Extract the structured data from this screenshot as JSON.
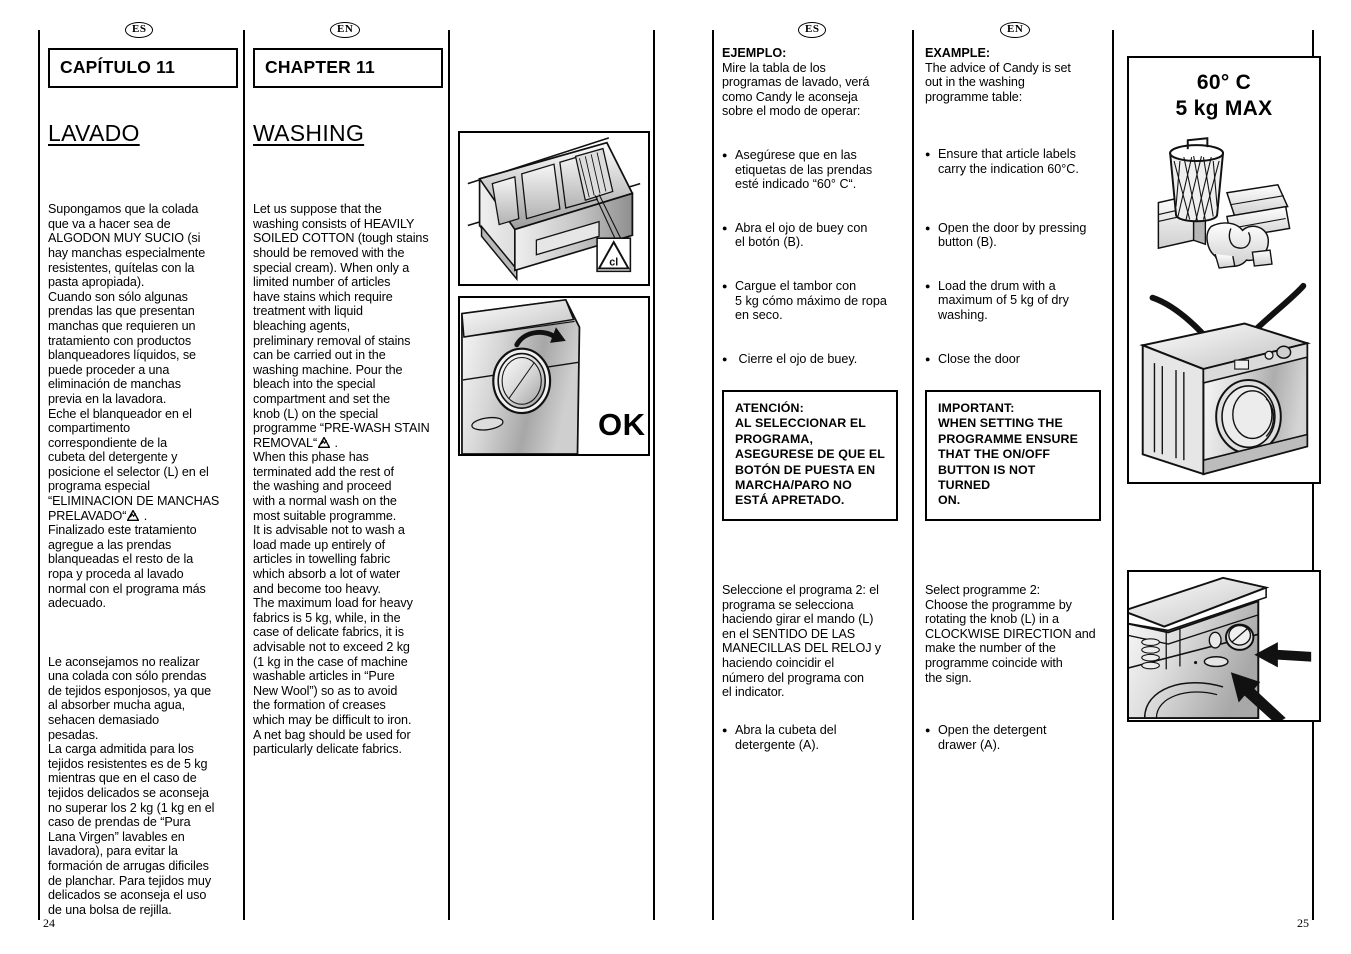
{
  "document": {
    "page_left_number": "24",
    "page_right_number": "25"
  },
  "left_page": {
    "es": {
      "lang_badge": "ES",
      "chapter_label": "CAPÍTULO 11",
      "section_title": "LAVADO",
      "paragraphs": [
        "Supongamos que la colada\nque va a hacer sea de\nALGODON MUY SUCIO (si\nhay manchas especialmente\nresistentes, quítelas con la\npasta apropiada).\nCuando son sólo algunas\nprendas las que presentan\nmanchas que requieren un\ntratamiento con productos\nblanqueadores líquidos, se\npuede proceder a una\neliminación de manchas\nprevia en la lavadora.\nEche el blanqueador en el\ncompartimento\ncorrespondiente de la\ncubeta del detergente y\nposicione el selector (L) en el\nprograma especial\n“ELIMINACION DE MANCHAS\nPRELAVADO“",
        " .\nFinalizado este tratamiento\nagregue a las prendas\nblanqueadas el resto de la\nropa y proceda al lavado\nnormal con el programa más\nadecuado.",
        "Le aconsejamos no realizar\nuna colada con sólo prendas\nde tejidos esponjosos, ya que\nal absorber mucha agua,\nsehacen demasiado\npesadas.\nLa carga admitida para los\ntejidos resistentes es de 5 kg\nmientras que en el caso de\ntejidos delicados se aconseja\nno superar los 2 kg (1 kg en el\ncaso de prendas de “Pura\nLana Virgen” lavables en\nlavadora), para evitar la\nformación de arrugas dificiles\nde planchar. Para tejidos muy\ndelicados se aconseja el uso\nde una bolsa de rejilla."
      ]
    },
    "en": {
      "lang_badge": "EN",
      "chapter_label": "CHAPTER 11",
      "section_title": "WASHING",
      "paragraphs": [
        "Let us suppose that the\nwashing consists of HEAVILY\nSOILED COTTON (tough stains\nshould be removed with the\nspecial cream). When only a\nlimited number of articles\nhave stains which require\ntreatment with liquid\nbleaching agents,\npreliminary removal of stains\ncan be carried out in the\nwashing machine. Pour the\nbleach into the special\ncompartment and set the\nknob (L) on the special\nprogramme “PRE-WASH STAIN\nREMOVAL“",
        " .\nWhen this phase has\nterminated add the rest of\nthe washing and proceed\nwith a normal wash on the\nmost suitable programme.\nIt is advisable not to wash a\nload made up entirely of\narticles in towelling fabric\nwhich absorb a lot of water\nand become too heavy.\nThe maximum load for heavy\nfabrics is 5 kg, while, in the\ncase of delicate fabrics, it is\nadvisable not to exceed 2 kg\n(1 kg in the case of machine\nwashable articles in “Pure\nNew Wool”) so as to avoid\nthe formation of creases\nwhich may be difficult to iron.\nA net bag should be used for\nparticularly delicate fabrics."
      ]
    },
    "figures": {
      "detergent_drawer": {
        "name": "detergent-drawer-open",
        "bleach_symbol_text": "cl"
      },
      "door_knob_ok": {
        "name": "door-closing-ok",
        "ok_label": "OK"
      }
    }
  },
  "right_page": {
    "es": {
      "lang_badge": "ES",
      "example_heading": "EJEMPLO:",
      "example_intro": "Mire la tabla de los\nprogramas de lavado, verá\ncomo Candy le aconseja\nsobre el modo de operar:",
      "bullets": [
        "Asegúrese que en las\netiquetas de las prendas\nesté indicado “60° C“.",
        "Abra el ojo de buey con\nel botón (B).",
        "Cargue el tambor con\n5 kg cómo máximo de ropa\nen seco.",
        " Cierre el ojo de buey."
      ],
      "warning": "ATENCIÓN:\nAL SELECCIONAR EL\nPROGRAMA,\nASEGURESE DE QUE EL\nBOTÓN DE PUESTA EN\nMARCHA/PARO NO\nESTÁ APRETADO.",
      "select_text": "Seleccione el programa 2: el\nprograma se selecciona\nhaciendo girar el mando (L)\nen el SENTIDO DE LAS\nMANECILLAS DEL RELOJ y\nhaciendo coincidir el\nnúmero del programa con\nel indicator.",
      "final_bullet": "Abra la cubeta del\ndetergente (A)."
    },
    "en": {
      "lang_badge": "EN",
      "example_heading": "EXAMPLE:",
      "example_intro": "The advice of Candy is set\nout in the washing\nprogramme table:",
      "bullets": [
        "Ensure that article labels\ncarry the indication 60°C.",
        "Open the door by pressing\nbutton (B).",
        "Load the drum with a\nmaximum of 5 kg of dry\nwashing.",
        "Close the door"
      ],
      "warning": "IMPORTANT:\nWHEN SETTING THE\nPROGRAMME ENSURE\nTHAT THE ON/OFF\nBUTTON IS NOT TURNED\nON.",
      "select_text": "Select programme 2:\nChoose the programme by\nrotating the knob (L) in a\nCLOCKWISE DIRECTION and\nmake the number of the\nprogramme coincide with\nthe sign.",
      "final_bullet": "Open the detergent\ndrawer (A)."
    },
    "figures": {
      "laundry_load": {
        "name": "laundry-basket-load",
        "caption_line1": "60° C",
        "caption_line2": "5 kg MAX"
      },
      "machine_loading": {
        "name": "washing-machine-loading"
      },
      "control_panel": {
        "name": "control-panel-knob-arrows"
      }
    }
  },
  "colors": {
    "ink": "#000000",
    "paper": "#ffffff",
    "metal_light": "#f2f2f2",
    "metal_mid": "#c9c9c9",
    "metal_dark": "#8d8d8d"
  }
}
